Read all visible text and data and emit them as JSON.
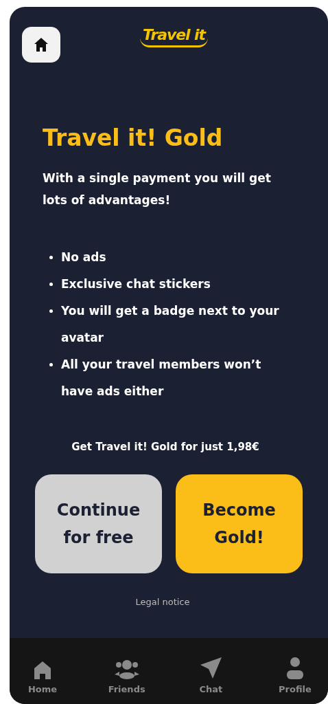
{
  "header": {
    "logo": "Travel it"
  },
  "title": "Travel it! Gold",
  "intro": "With a single payment you will get lots of advantages!",
  "benefits": [
    "No ads",
    "Exclusive chat stickers",
    "You will get a badge next to your avatar",
    "All your travel members won’t have ads either"
  ],
  "price_note": "Get Travel it! Gold for just 1,98€",
  "buttons": [
    {
      "label": "Continue for free",
      "kind": "secondary"
    },
    {
      "label": "Become Gold!",
      "kind": "primary"
    }
  ],
  "legal_link": "Legal notice",
  "bottom_nav": [
    {
      "label": "Home",
      "kind": "home"
    },
    {
      "label": "Friends",
      "kind": "friends"
    },
    {
      "label": "Chat",
      "kind": "chat"
    },
    {
      "label": "Profile",
      "kind": "profile"
    }
  ]
}
